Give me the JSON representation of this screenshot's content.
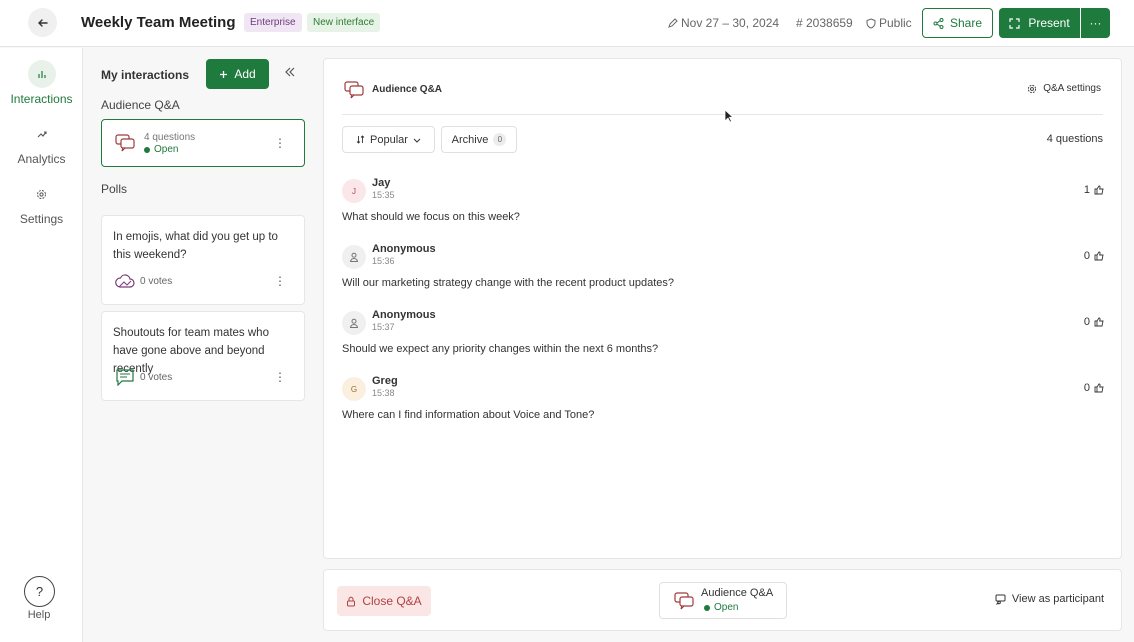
{
  "header": {
    "title": "Weekly Team Meeting",
    "badges": [
      "Enterprise",
      "New interface"
    ],
    "dates": "Nov 27 – 30, 2024",
    "event_code": "# 2038659",
    "visibility": "Public",
    "share_label": "Share",
    "present_label": "Present",
    "more_label": "···"
  },
  "rail": {
    "items": [
      {
        "label": "Interactions",
        "icon": "bar-chart-icon"
      },
      {
        "label": "Analytics",
        "icon": "trend-icon"
      },
      {
        "label": "Settings",
        "icon": "gear-icon"
      }
    ],
    "help_label": "Help",
    "help_glyph": "?"
  },
  "interactions": {
    "title": "My interactions",
    "add_label": "Add",
    "qa_section": "Audience Q&A",
    "qa_card": {
      "count": "4 questions",
      "status": "Open"
    },
    "polls_section": "Polls",
    "polls": [
      {
        "text": "In emojis, what did you get up to this weekend?",
        "votes": "0 votes",
        "icon": "cloud-icon"
      },
      {
        "text": "Shoutouts for team mates who have gone above and beyond recently",
        "votes": "0 votes",
        "icon": "chat-icon"
      }
    ]
  },
  "main": {
    "title": "Audience Q&A",
    "settings_label": "Q&A settings",
    "sort_label": "Popular",
    "archive_label": "Archive",
    "archive_count": "0",
    "question_count": "4 questions",
    "questions": [
      {
        "author": "Jay",
        "initial": "J",
        "time": "15:35",
        "text": "What should we focus on this week?",
        "likes": "1",
        "avatar_bg": "#fbe6ea",
        "avatar_fg": "#b24a5a"
      },
      {
        "author": "Anonymous",
        "initial": "",
        "time": "15:36",
        "text": "Will our marketing strategy change with the recent product updates?",
        "likes": "0",
        "avatar_bg": "#f0f0f0",
        "avatar_fg": "#777"
      },
      {
        "author": "Anonymous",
        "initial": "",
        "time": "15:37",
        "text": "Should we expect any priority changes within the next 6 months?",
        "likes": "0",
        "avatar_bg": "#f0f0f0",
        "avatar_fg": "#777"
      },
      {
        "author": "Greg",
        "initial": "G",
        "time": "15:38",
        "text": "Where can I find information about Voice and Tone?",
        "likes": "0",
        "avatar_bg": "#fbf0e0",
        "avatar_fg": "#a06a20"
      }
    ]
  },
  "footer": {
    "close_label": "Close Q&A",
    "card_title": "Audience Q&A",
    "card_status": "Open",
    "view_label": "View as participant"
  },
  "colors": {
    "accent": "#1f7a3d",
    "danger": "#b24141",
    "qa_icon": "#a03a3a"
  }
}
